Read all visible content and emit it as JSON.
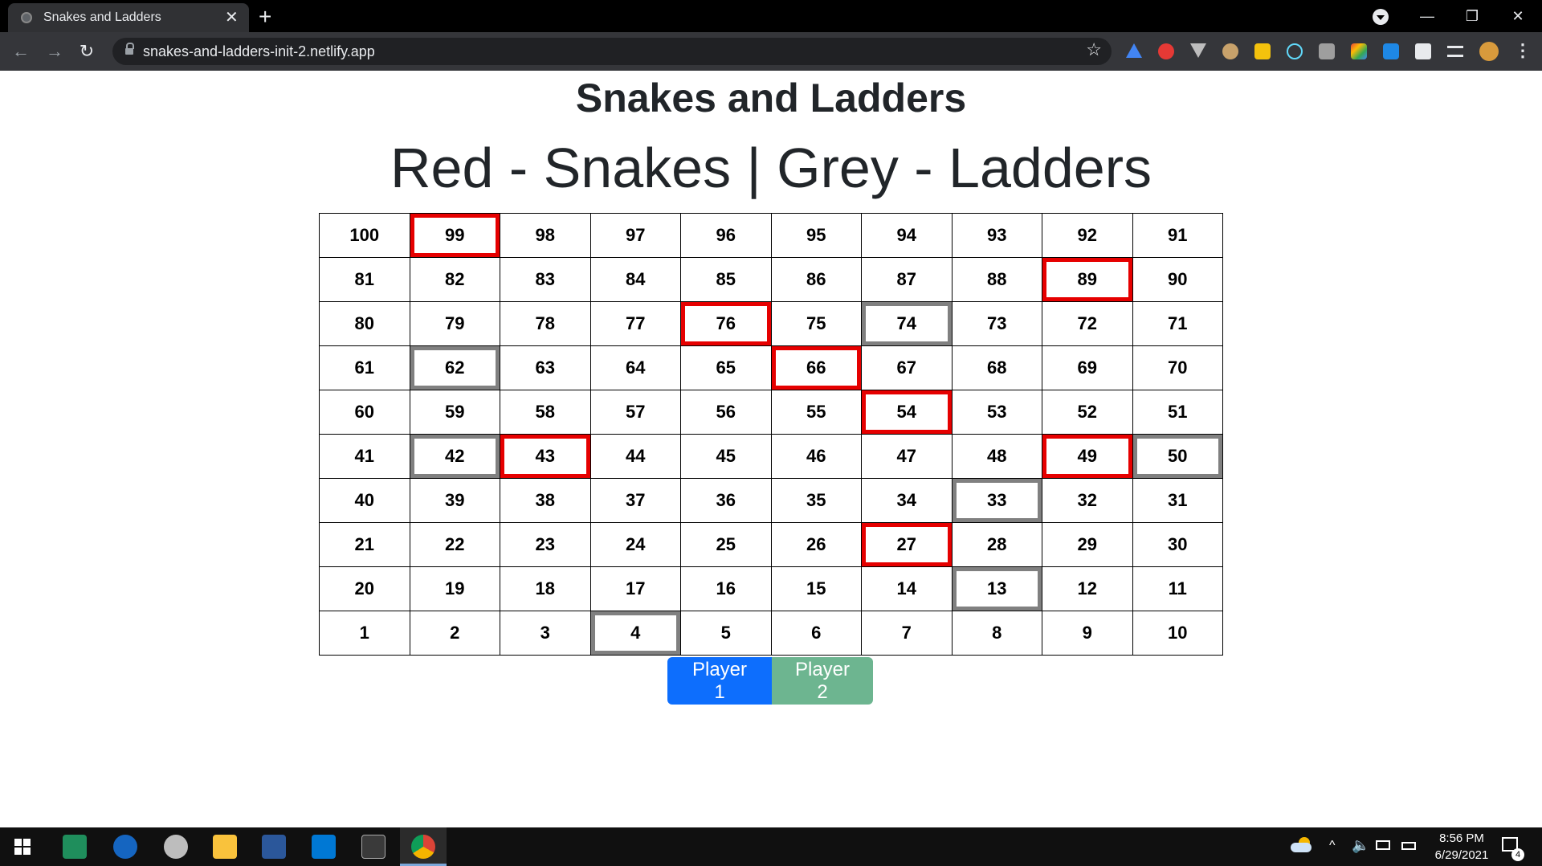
{
  "browser": {
    "tab_title": "Snakes and Ladders",
    "tab_close": "✕",
    "new_tab": "+",
    "url": "snakes-and-ladders-init-2.netlify.app",
    "window_buttons": {
      "minimize": "—",
      "restore": "❐",
      "close": "✕"
    },
    "nav": {
      "back": "←",
      "forward": "→",
      "reload": "↻"
    },
    "star": "☆",
    "menu": "⋮",
    "extension_icons": [
      "drive-icon",
      "adblock-icon",
      "vue-devtools-icon",
      "cookie-icon",
      "notes-icon",
      "react-devtools-icon",
      "chat-icon",
      "color-picker-icon",
      "clipper-icon",
      "puzzle-extensions-icon",
      "media-queue-icon",
      "profile-avatar-icon"
    ],
    "colors": {
      "titlebar": "#000000",
      "toolbar": "#35363a",
      "omnibox": "#202124"
    }
  },
  "page": {
    "title": "Snakes and Ladders",
    "subtitle": "Red - Snakes | Grey - Ladders"
  },
  "board": {
    "rows": [
      [
        100,
        99,
        98,
        97,
        96,
        95,
        94,
        93,
        92,
        91
      ],
      [
        81,
        82,
        83,
        84,
        85,
        86,
        87,
        88,
        89,
        90
      ],
      [
        80,
        79,
        78,
        77,
        76,
        75,
        74,
        73,
        72,
        71
      ],
      [
        61,
        62,
        63,
        64,
        65,
        66,
        67,
        68,
        69,
        70
      ],
      [
        60,
        59,
        58,
        57,
        56,
        55,
        54,
        53,
        52,
        51
      ],
      [
        41,
        42,
        43,
        44,
        45,
        46,
        47,
        48,
        49,
        50
      ],
      [
        40,
        39,
        38,
        37,
        36,
        35,
        34,
        33,
        32,
        31
      ],
      [
        21,
        22,
        23,
        24,
        25,
        26,
        27,
        28,
        29,
        30
      ],
      [
        20,
        19,
        18,
        17,
        16,
        15,
        14,
        13,
        12,
        11
      ],
      [
        1,
        2,
        3,
        4,
        5,
        6,
        7,
        8,
        9,
        10
      ]
    ],
    "snakes": [
      99,
      89,
      76,
      66,
      54,
      43,
      49,
      27
    ],
    "ladders": [
      74,
      62,
      42,
      50,
      33,
      13,
      4
    ],
    "colors": {
      "snake": "#e60000",
      "ladder": "#808080"
    }
  },
  "players": {
    "player1_label": "Player 1",
    "player2_label": "Player 2",
    "colors": {
      "player1": "#0d6efd",
      "player2": "#6db590"
    }
  },
  "taskbar": {
    "apps": [
      "datagrip-icon",
      "wordpad-icon",
      "mongodb-compass-icon",
      "file-explorer-icon",
      "word-icon",
      "vscode-icon",
      "terminal-icon",
      "chrome-icon"
    ],
    "clock_time": "8:56 PM",
    "clock_date": "6/29/2021",
    "notification_count": "4"
  }
}
